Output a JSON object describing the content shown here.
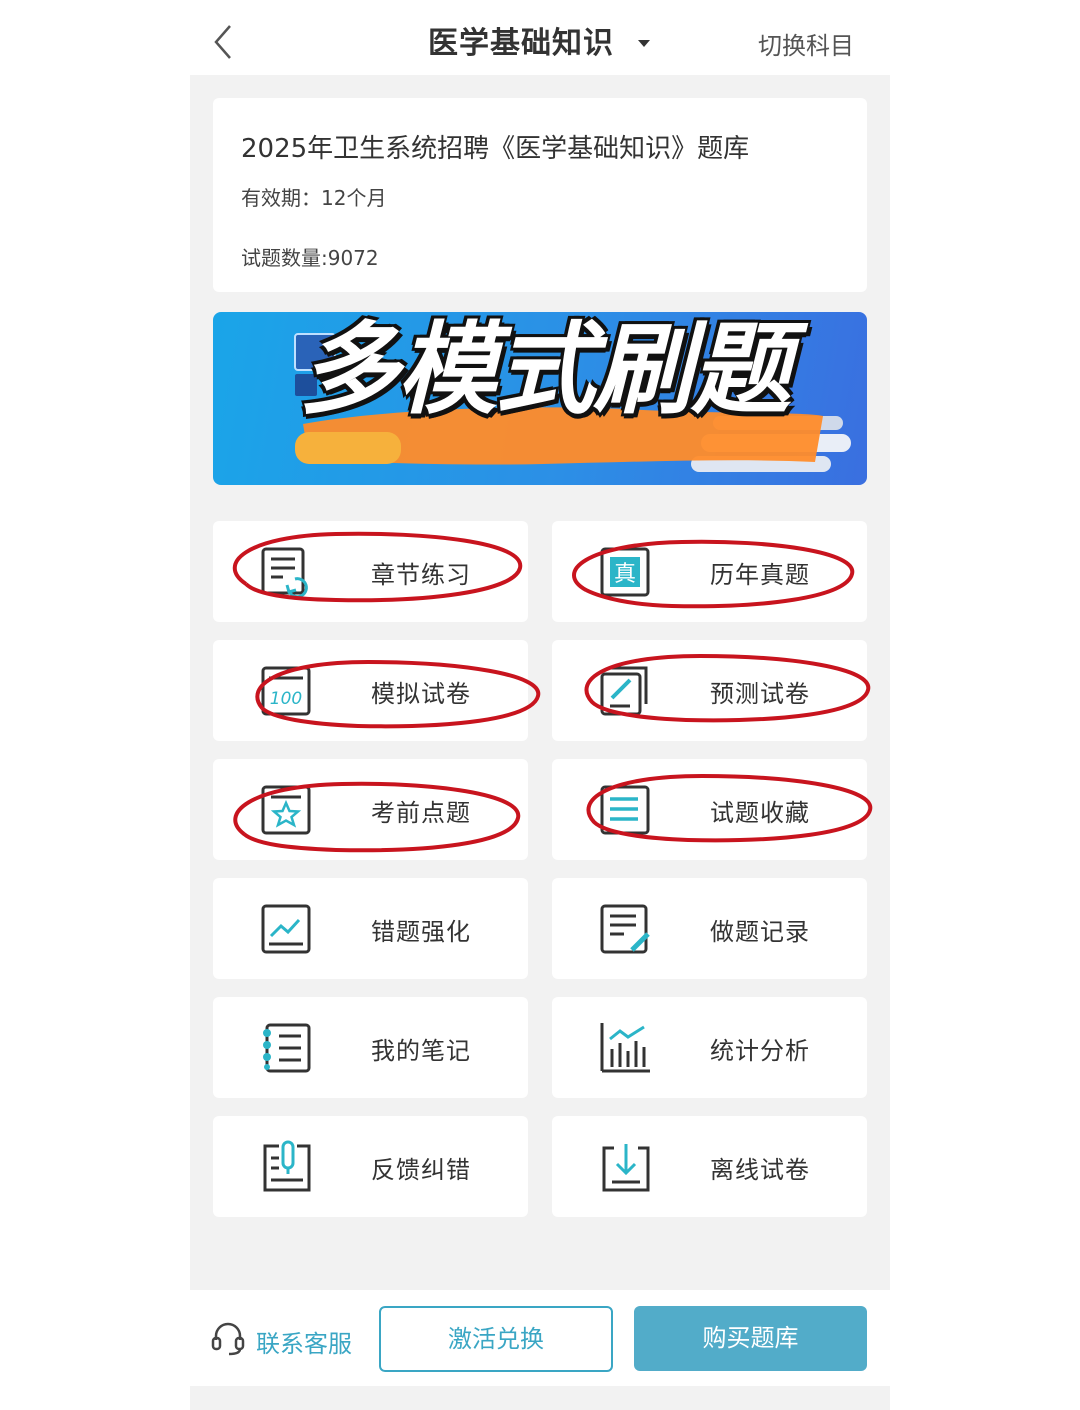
{
  "header": {
    "title": "医学基础知识",
    "switch_label": "切换科目"
  },
  "info": {
    "title": "2025年卫生系统招聘《医学基础知识》题库",
    "validity": "有效期：12个月",
    "count": "试题数量:9072"
  },
  "banner": {
    "headline": "多模式刷题",
    "colors": {
      "bg_start": "#1aa5e8",
      "bg_end": "#3a6fe0",
      "stroke": "#ff8c2a"
    }
  },
  "menu": [
    {
      "label": "章节练习",
      "icon": "chapter-practice-icon"
    },
    {
      "label": "历年真题",
      "icon": "past-exams-icon"
    },
    {
      "label": "模拟试卷",
      "icon": "mock-exam-icon"
    },
    {
      "label": "预测试卷",
      "icon": "prediction-exam-icon"
    },
    {
      "label": "考前点题",
      "icon": "key-points-icon"
    },
    {
      "label": "试题收藏",
      "icon": "favorites-icon"
    },
    {
      "label": "错题强化",
      "icon": "wrong-questions-icon"
    },
    {
      "label": "做题记录",
      "icon": "practice-record-icon"
    },
    {
      "label": "我的笔记",
      "icon": "notes-icon"
    },
    {
      "label": "统计分析",
      "icon": "statistics-icon"
    },
    {
      "label": "反馈纠错",
      "icon": "feedback-icon"
    },
    {
      "label": "离线试卷",
      "icon": "offline-exam-icon"
    }
  ],
  "footer": {
    "service_label": "联系客服",
    "activate_label": "激活兑换",
    "buy_label": "购买题库",
    "accent": "#3aa6c4",
    "buy_bg": "#52acc9"
  },
  "colors": {
    "annotation_ring": "#c8141e",
    "icon_stroke": "#333333",
    "icon_accent": "#2bb5c8"
  }
}
